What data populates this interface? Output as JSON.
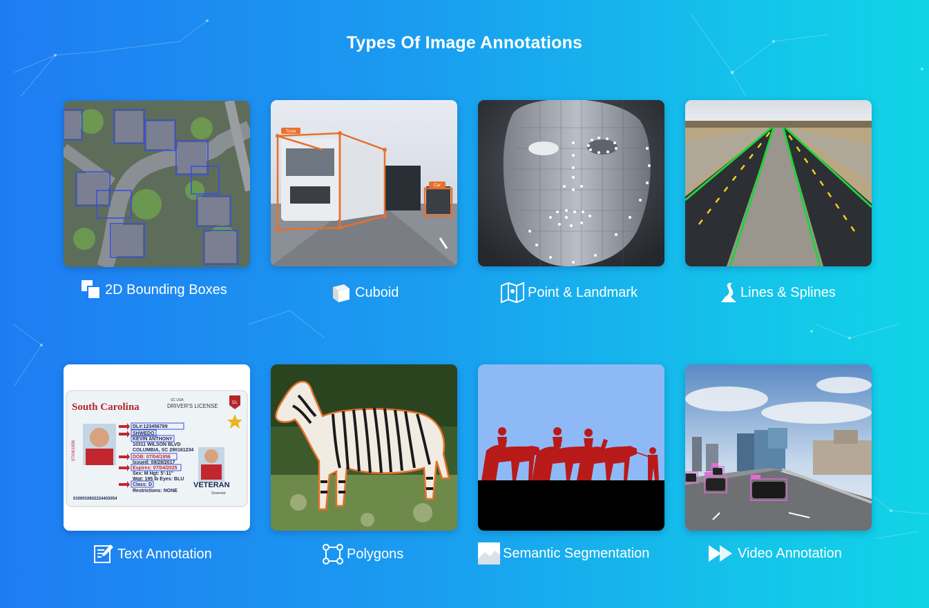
{
  "page": {
    "title": "Types Of Image Annotations"
  },
  "annotation_types": [
    {
      "label": "2D Bounding Boxes",
      "icon": "bounding-box-icon"
    },
    {
      "label": "Cuboid",
      "icon": "cube-icon"
    },
    {
      "label": "Point & Landmark",
      "icon": "map-points-icon"
    },
    {
      "label": "Lines & Splines",
      "icon": "road-icon"
    },
    {
      "label": "Text Annotation",
      "icon": "document-edit-icon"
    },
    {
      "label": "Polygons",
      "icon": "polygon-icon"
    },
    {
      "label": "Semantic Segmentation",
      "icon": "image-segment-icon"
    },
    {
      "label": "Video Annotation",
      "icon": "fast-forward-icon"
    }
  ],
  "thumbnails": {
    "cuboid_tags": [
      "Truck",
      "Car"
    ],
    "license": {
      "state": "South Carolina",
      "header": "DRIVER'S LICENSE",
      "sc_usa": "SC USA",
      "dl_badge": "DL",
      "dl_number": "DL#:123456789",
      "last_name": "SHWEDO",
      "first_name": "KEVIN ANTHONY",
      "address1": "10311 WILSON BLVD",
      "address2": "COLUMBIA, SC 290161234",
      "dob": "DOB: 07/04/1956",
      "issued": "Issued: 09/28/2017",
      "expires": "Expires: 07/04/2025",
      "sex_hgt": "Sex: M  Hgt: 5'-11\"",
      "wgt_eyes": "Wgt: 195 lb  Eyes: BLU",
      "class": "Class: D",
      "restrictions": "Restrictions: NONE",
      "side_number": "07/04/1956",
      "bottom_number": "0100010602224403054",
      "veteran": "VETERAN",
      "governor": "Governor"
    }
  },
  "colors": {
    "gradient_left": "#1e7cf2",
    "gradient_right": "#10d4e6",
    "annotation_orange": "#e8702a",
    "lane_green": "#22d23a",
    "box_blue": "#3a4ee0",
    "camel_red": "#b81a1a",
    "sky_blue": "#8eb9f7"
  }
}
